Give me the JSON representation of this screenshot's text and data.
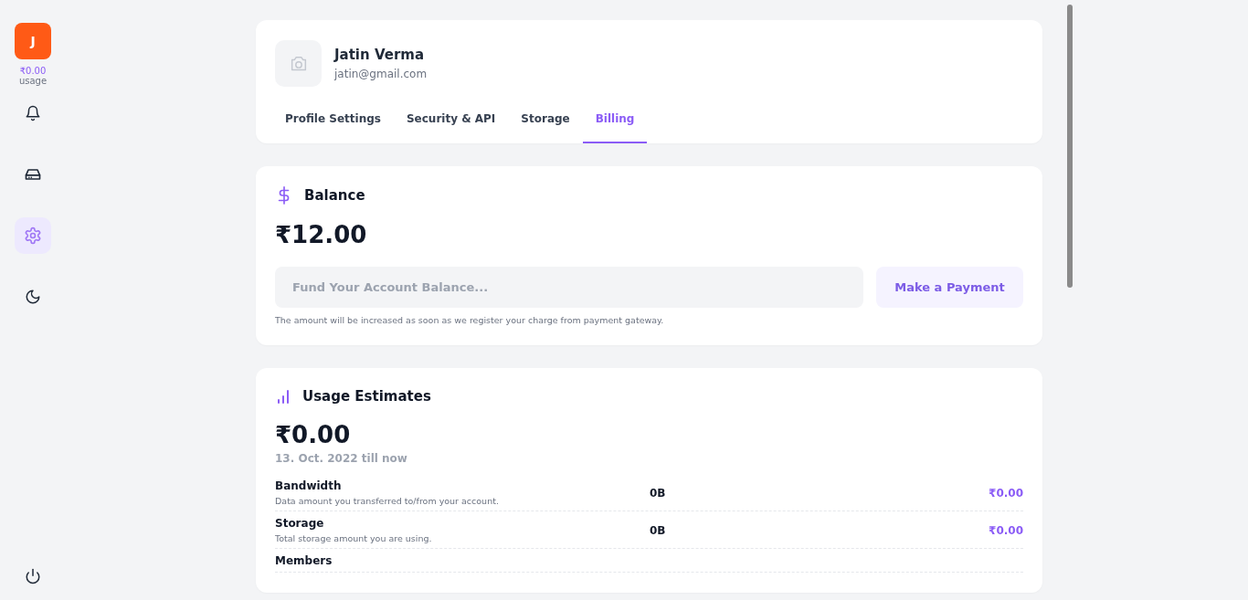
{
  "sidebar": {
    "avatar": {
      "initial": "J"
    },
    "usage": {
      "amount": "₹0.00",
      "label": "usage"
    },
    "items": [
      {
        "kind": "bell",
        "selected": false
      },
      {
        "kind": "drive",
        "selected": false
      },
      {
        "kind": "gear",
        "selected": true
      },
      {
        "kind": "moon",
        "selected": false
      }
    ]
  },
  "profile": {
    "name": "Jatin Verma",
    "email": "jatin@gmail.com",
    "tabs": [
      {
        "label": "Profile Settings",
        "selected": false
      },
      {
        "label": "Security & API",
        "selected": false
      },
      {
        "label": "Storage",
        "selected": false
      },
      {
        "label": "Billing",
        "selected": true
      }
    ]
  },
  "balance": {
    "title": "Balance",
    "amount": "₹12.00",
    "field": {
      "placeholder": "Fund Your Account Balance..."
    },
    "button": "Make a Payment",
    "note": "The amount will be increased as soon as we register your charge from payment gateway."
  },
  "usage": {
    "title": "Usage Estimates",
    "amount": "₹0.00",
    "period": "13. Oct. 2022 till now",
    "rows": [
      {
        "name": "Bandwidth",
        "description": "Data amount you transferred to/from your account.",
        "quantity": "0B",
        "cost": "₹0.00"
      },
      {
        "name": "Storage",
        "description": "Total storage amount you are using.",
        "quantity": "0B",
        "cost": "₹0.00"
      },
      {
        "name": "Members"
      }
    ]
  }
}
